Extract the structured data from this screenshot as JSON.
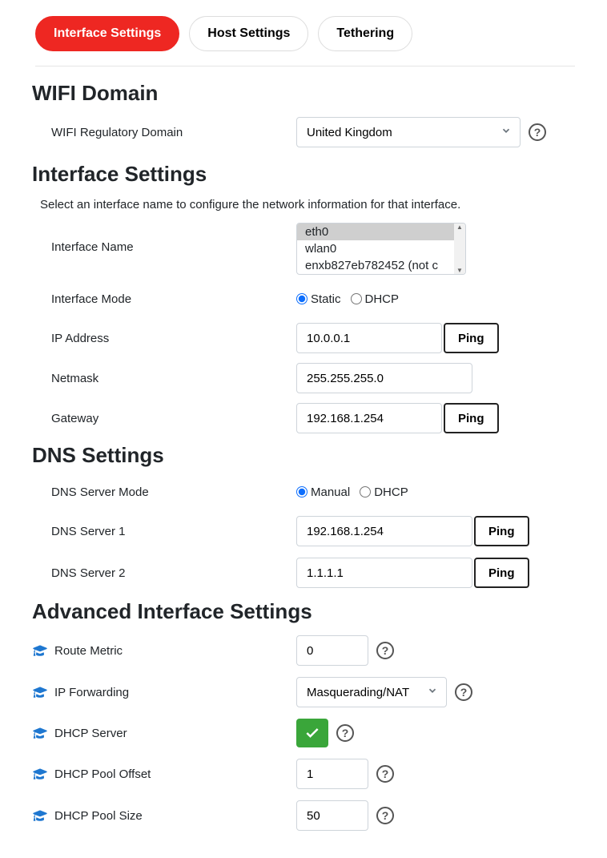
{
  "tabs": {
    "interface": "Interface Settings",
    "host": "Host Settings",
    "tether": "Tethering"
  },
  "wifi_domain": {
    "heading": "WIFI Domain",
    "label": "WIFI Regulatory Domain",
    "selected": "United Kingdom"
  },
  "interface_settings": {
    "heading": "Interface Settings",
    "subtext": "Select an interface name to configure the network information for that interface.",
    "name_label": "Interface Name",
    "name_options": {
      "a": "eth0",
      "b": "wlan0",
      "c": "enxb827eb782452 (not c"
    },
    "mode_label": "Interface Mode",
    "mode_static": "Static",
    "mode_dhcp": "DHCP",
    "ip_label": "IP Address",
    "ip_value": "10.0.0.1",
    "netmask_label": "Netmask",
    "netmask_value": "255.255.255.0",
    "gateway_label": "Gateway",
    "gateway_value": "192.168.1.254",
    "ping": "Ping"
  },
  "dns": {
    "heading": "DNS Settings",
    "mode_label": "DNS Server Mode",
    "mode_manual": "Manual",
    "mode_dhcp": "DHCP",
    "s1_label": "DNS Server 1",
    "s1_value": "192.168.1.254",
    "s2_label": "DNS Server 2",
    "s2_value": "1.1.1.1"
  },
  "advanced": {
    "heading": "Advanced Interface Settings",
    "route_metric_label": "Route Metric",
    "route_metric_value": "0",
    "ip_fwd_label": "IP Forwarding",
    "ip_fwd_value": "Masquerading/NAT",
    "dhcp_server_label": "DHCP Server",
    "pool_offset_label": "DHCP Pool Offset",
    "pool_offset_value": "1",
    "pool_size_label": "DHCP Pool Size",
    "pool_size_value": "50"
  },
  "help": "?"
}
